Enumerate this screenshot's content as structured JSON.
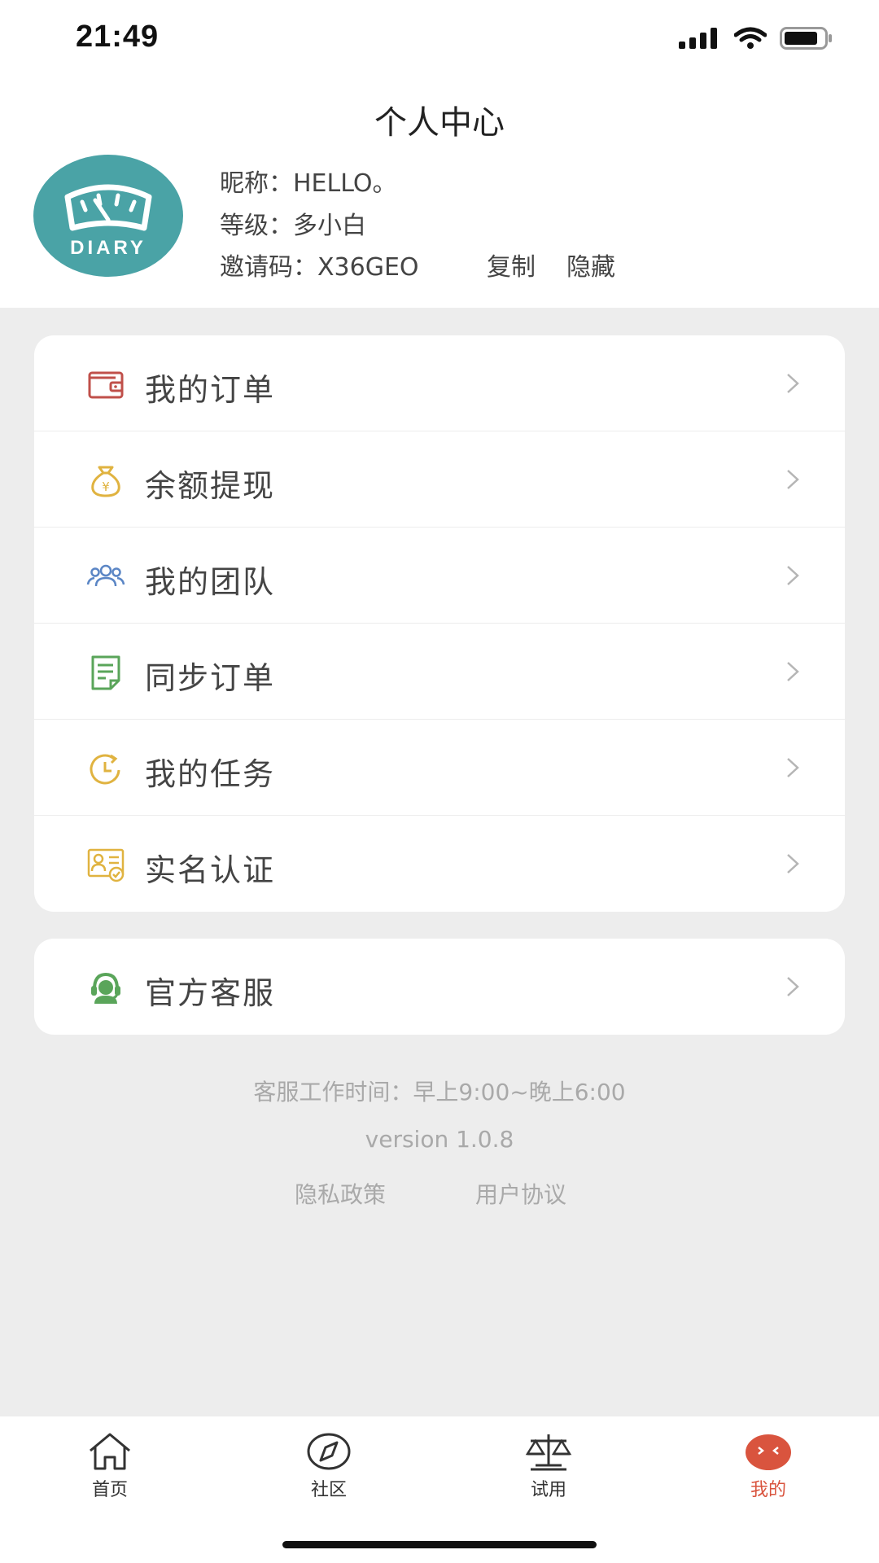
{
  "status_bar": {
    "time": "21:49"
  },
  "header": {
    "title": "个人中心",
    "avatar_text": "DIARY",
    "nickname_label": "昵称：",
    "nickname": "HELLO。",
    "level_label": "等级：",
    "level": "多小白",
    "invite_label": "邀请码：",
    "invite_code": "X36GEO",
    "copy_label": "复制",
    "hide_label": "隐藏"
  },
  "menu": {
    "items": [
      {
        "label": "我的订单",
        "icon": "wallet-icon",
        "color": "#c0504a"
      },
      {
        "label": "余额提现",
        "icon": "money-bag-icon",
        "color": "#e0b340"
      },
      {
        "label": "我的团队",
        "icon": "team-icon",
        "color": "#5b86c5"
      },
      {
        "label": "同步订单",
        "icon": "document-icon",
        "color": "#5aa55a"
      },
      {
        "label": "我的任务",
        "icon": "clock-icon",
        "color": "#e0b340"
      },
      {
        "label": "实名认证",
        "icon": "id-card-icon",
        "color": "#e0b340"
      }
    ],
    "service": {
      "label": "官方客服",
      "icon": "headset-icon",
      "color": "#5aa55a"
    }
  },
  "footer": {
    "service_hours": "客服工作时间：早上9:00~晚上6:00",
    "version": "version 1.0.8",
    "privacy": "隐私政策",
    "agreement": "用户协议"
  },
  "tabbar": {
    "tabs": [
      {
        "label": "首页",
        "icon": "home-icon"
      },
      {
        "label": "社区",
        "icon": "compass-icon"
      },
      {
        "label": "试用",
        "icon": "scale-icon"
      },
      {
        "label": "我的",
        "icon": "profile-face-icon",
        "active": true
      }
    ],
    "active_color": "#d9543e"
  }
}
